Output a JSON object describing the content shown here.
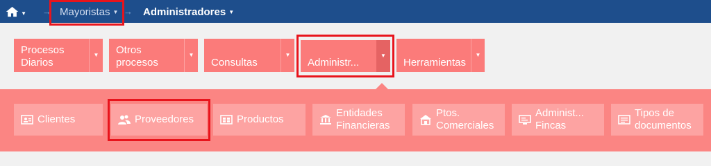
{
  "breadcrumb": {
    "home_icon": "home-icon",
    "items": [
      {
        "label": "Mayoristas"
      },
      {
        "label": "Administradores"
      }
    ]
  },
  "categories": [
    {
      "line1": "Procesos",
      "line2": "Diarios"
    },
    {
      "line1": "Otros",
      "line2": "procesos"
    },
    {
      "line1": "",
      "line2": "Consultas"
    },
    {
      "line1": "",
      "line2": "Administr..."
    },
    {
      "line1": "",
      "line2": "Herramientas"
    }
  ],
  "submenu": [
    {
      "line1": "Clientes",
      "line2": "",
      "icon": "contact-card-icon"
    },
    {
      "line1": "Proveedores",
      "line2": "",
      "icon": "users-icon"
    },
    {
      "line1": "Productos",
      "line2": "",
      "icon": "products-grid-icon"
    },
    {
      "line1": "Entidades",
      "line2": "Financieras",
      "icon": "bank-icon"
    },
    {
      "line1": "Ptos.",
      "line2": "Comerciales",
      "icon": "store-icon"
    },
    {
      "line1": "Administ...",
      "line2": "Fincas",
      "icon": "monitor-icon"
    },
    {
      "line1": "Tipos de",
      "line2": "documentos",
      "icon": "document-list-icon"
    }
  ],
  "colors": {
    "topbar": "#1e4e8c",
    "category": "#fb7b7a",
    "panel": "#fb8583",
    "submenu_button": "#fda3a2",
    "highlight": "#e8141c"
  }
}
